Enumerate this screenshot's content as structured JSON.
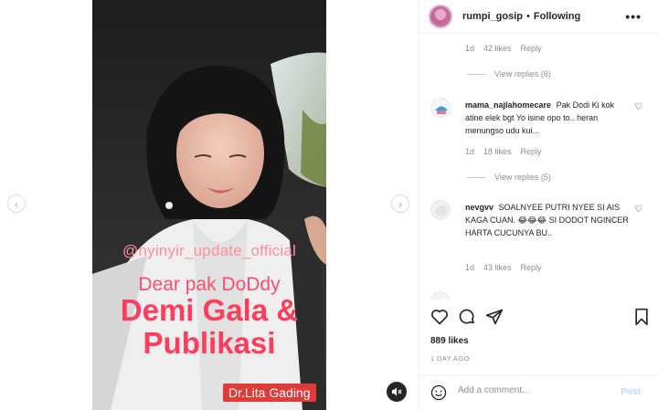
{
  "media": {
    "overlay_handle": "@nyinyir_update_official",
    "overlay_dear": "Dear pak DoDdy",
    "overlay_line1": "Demi Gala &",
    "overlay_line2": "Publikasi",
    "doctor_label": "Dr.Lita Gading",
    "dots_total": 3,
    "active_dot_index": 1
  },
  "header": {
    "username": "rumpi_gosip",
    "separator": "•",
    "following": "Following",
    "more": "•••"
  },
  "comments": {
    "top_meta": {
      "time": "1d",
      "likes": "42 likes",
      "reply": "Reply"
    },
    "top_view_replies": "View replies (6)",
    "items": [
      {
        "username": "mama_najlahomecare",
        "text": "Pak Dodi Ki kok atine elek bgt Yo isine opo to.. heran menungso udu kui...",
        "time": "1d",
        "likes": "18 likes",
        "reply": "Reply",
        "view_replies": "View replies (5)"
      },
      {
        "username": "nevgvv",
        "text": "SOALNYEE PUTRI NYEE SI AIS KAGA CUAN. 😂😂😂 SI DODOT NGINCER HARTA CUCUNYA BU..",
        "time": "1d",
        "likes": "43 likes",
        "reply": "Reply"
      }
    ]
  },
  "stats": {
    "likes": "889 likes",
    "ago": "1 DAY AGO"
  },
  "add_comment": {
    "placeholder": "Add a comment...",
    "post": "Post"
  },
  "icons": {
    "heart": "heart-icon",
    "comment": "comment-icon",
    "share": "paper-plane-icon",
    "save": "bookmark-icon",
    "emoji": "emoji-icon",
    "mute": "speaker-muted-icon",
    "prev": "chevron-left-icon",
    "next": "chevron-right-icon"
  },
  "colors": {
    "overlay_pink": "#ff3c5c",
    "doctor_label_bg": "#e03a3a",
    "post_disabled": "#b2dffc"
  }
}
